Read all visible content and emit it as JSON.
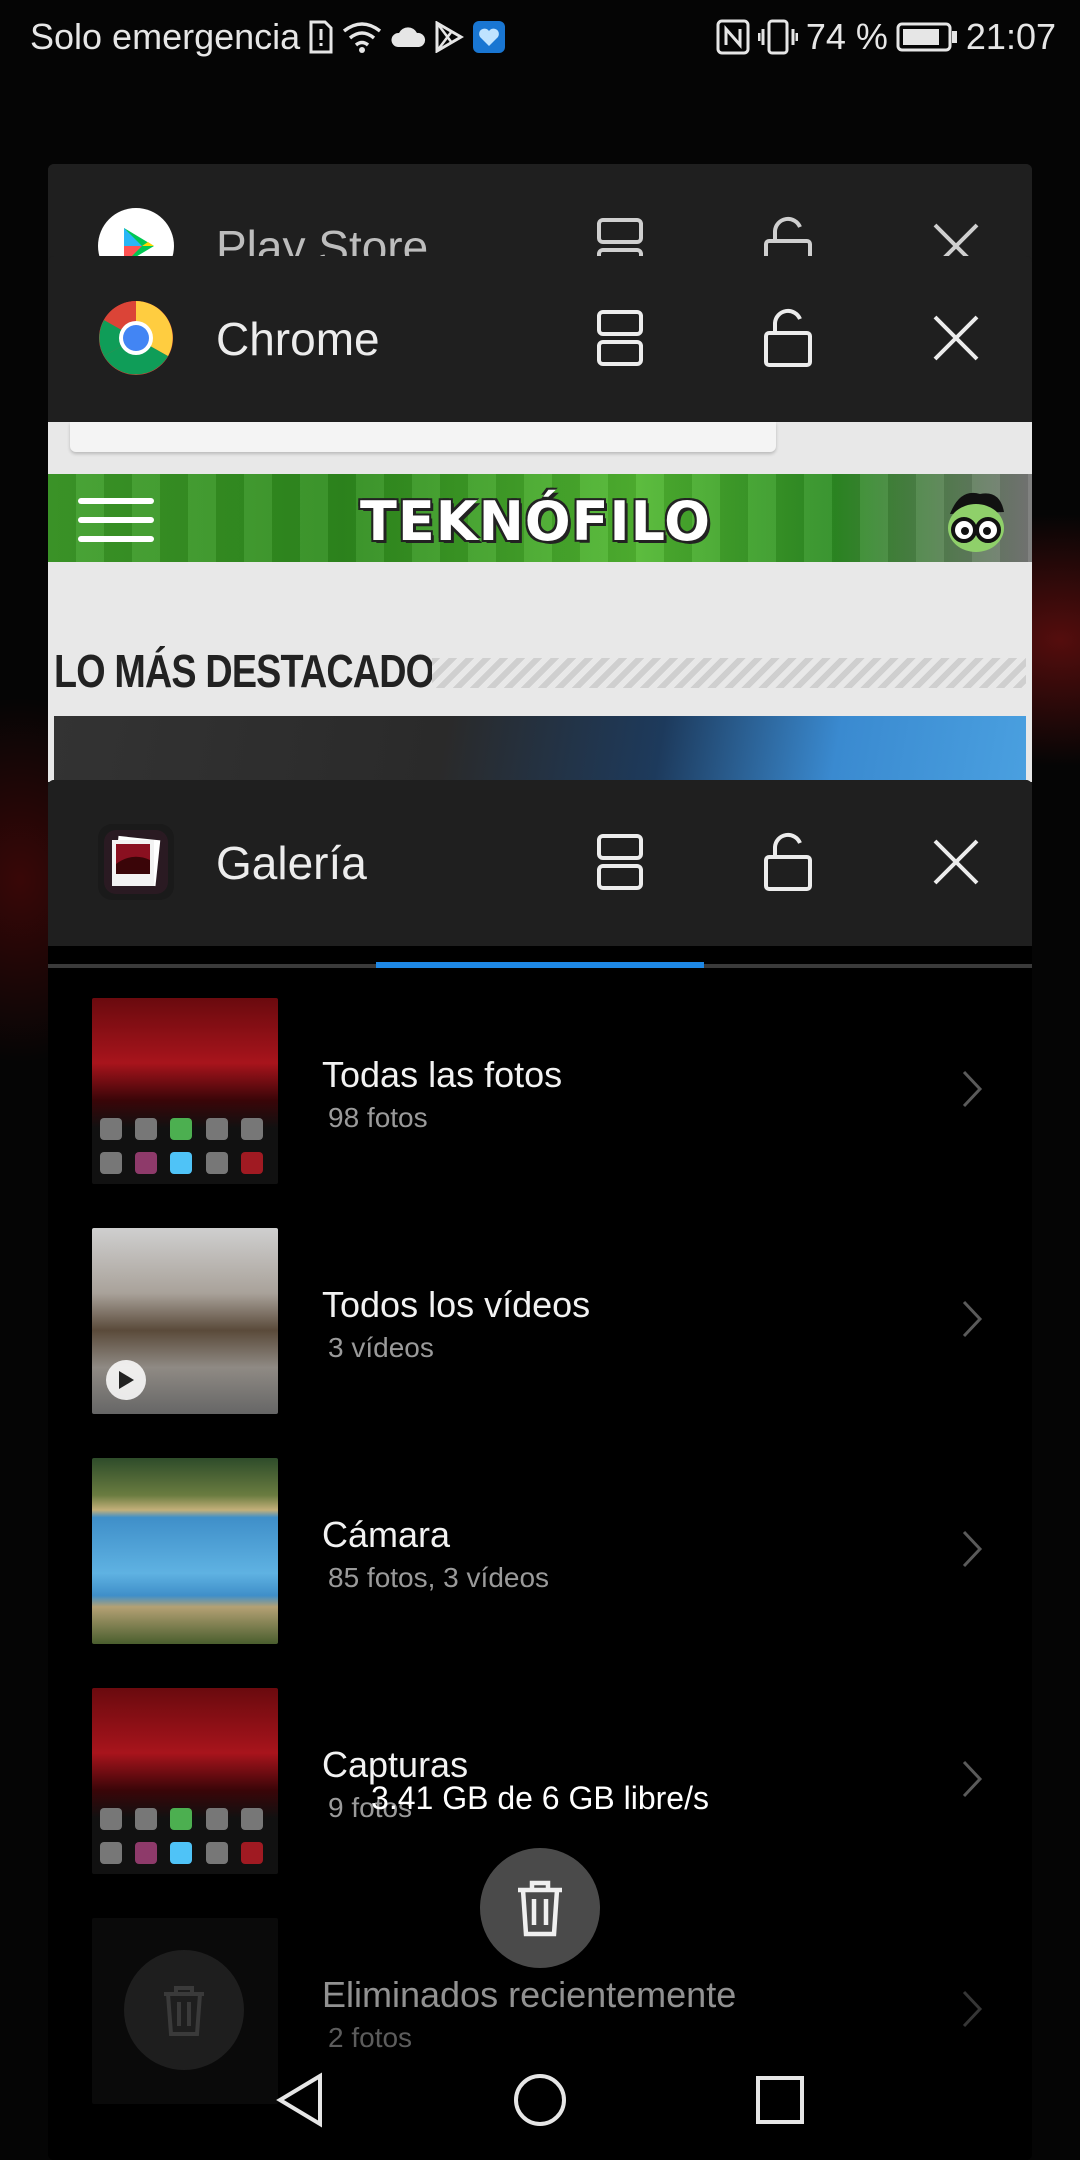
{
  "status_bar": {
    "carrier": "Solo emergencia",
    "battery_percent": "74 %",
    "time": "21:07",
    "icons_left": [
      "sim-alert-icon",
      "wifi-icon",
      "cloud-icon",
      "play-store-notification-icon",
      "app-notification-icon"
    ],
    "icons_right": [
      "nfc-icon",
      "vibrate-icon",
      "battery-icon"
    ]
  },
  "recents": {
    "cards": [
      {
        "app": "Play Store",
        "icon": "play-store-icon"
      },
      {
        "app": "Chrome",
        "icon": "chrome-icon"
      },
      {
        "app": "Galería",
        "icon": "gallery-icon"
      }
    ],
    "card_actions": [
      "split-screen-icon",
      "lock-icon",
      "close-icon"
    ]
  },
  "chrome_page": {
    "site_logo": "TEKNÓFILO",
    "section_heading": "LO MÁS DESTACADO"
  },
  "gallery": {
    "albums": [
      {
        "name": "Todas las fotos",
        "count": "98 fotos"
      },
      {
        "name": "Todos los vídeos",
        "count": "3 vídeos"
      },
      {
        "name": "Cámara",
        "count": "85 fotos,  3 vídeos"
      },
      {
        "name": "Capturas",
        "count": "9 fotos"
      },
      {
        "name": "Eliminados recientemente",
        "count": "2 fotos"
      }
    ]
  },
  "storage": "3.41 GB de 6 GB libre/s",
  "nav": [
    "back-icon",
    "home-icon",
    "recents-icon"
  ],
  "colors": {
    "accent": "#1e88e5",
    "card_header": "#1f1f1f",
    "background": "#000000"
  }
}
